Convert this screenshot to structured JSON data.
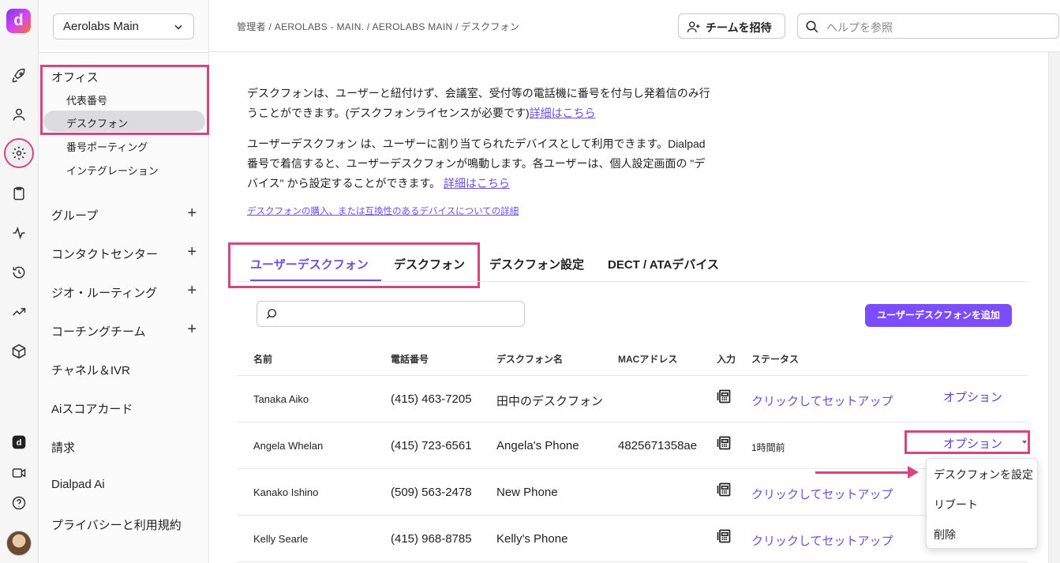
{
  "rail": {
    "logo": "d",
    "icons": [
      "rocket-icon",
      "person-icon",
      "gear-icon",
      "clipboard-icon",
      "activity-icon",
      "history-icon",
      "trending-icon",
      "cube-icon",
      "dialpad-icon",
      "video-icon",
      "help-icon",
      "avatar"
    ]
  },
  "nav": {
    "org": "Aerolabs Main",
    "office": "オフィス",
    "sub_items": [
      "代表番号",
      "デスクフォン",
      "番号ポーティング",
      "インテグレーション"
    ],
    "groups": [
      {
        "label": "グループ",
        "plus": "+"
      },
      {
        "label": "コンタクトセンター",
        "plus": "+"
      },
      {
        "label": "ジオ・ルーティング",
        "plus": "+"
      },
      {
        "label": "コーチングチーム",
        "plus": "+"
      },
      {
        "label": "チャネル＆IVR",
        "plus": ""
      },
      {
        "label": "Aiスコアカード",
        "plus": ""
      },
      {
        "label": "請求",
        "plus": ""
      },
      {
        "label": "Dialpad Ai",
        "plus": ""
      },
      {
        "label": "プライバシーと利用規約",
        "plus": ""
      }
    ]
  },
  "header": {
    "breadcrumb": "管理者 / AEROLABS - MAIN. / AEROLABS MAIN / デスクフォン",
    "invite_label": "チームを招待",
    "search_placeholder": "ヘルプを参照"
  },
  "intro": {
    "p1_line1": "デスクフォンは、ユーザーと紐付けず、会議室、受付等の電話機に番号を付与し発着信のみ行",
    "p1_line2": "うことができます。(デスクフォンライセンスが必要です)",
    "p1_link": "詳細はこちら",
    "p2_line1": "ユーザーデスクフォン は、ユーザーに割り当てられたデバイスとして利用できます。Dialpad",
    "p2_line2": "番号で着信すると、ユーザーデスクフォンが鳴動します。各ユーザーは、個人設定画面の \"デ",
    "p2_line3": "バイス\" から設定することができます。",
    "p2_link": "詳細はこちら",
    "purchase_link": "デスクフォンの購入、または互換性のあるデバイスについての詳細"
  },
  "tabs": [
    "ユーザーデスクフォン",
    "デスクフォン",
    "デスクフォン設定",
    "DECT / ATAデバイス"
  ],
  "add_button": "ユーザーデスクフォンを追加",
  "table": {
    "headers": [
      "名前",
      "電話番号",
      "デスクフォン名",
      "MACアドレス",
      "入力",
      "ステータス"
    ],
    "rows": [
      {
        "name": "Tanaka Aiko",
        "phone": "(415) 463-7205",
        "device": "田中のデスクフォン",
        "mac": "",
        "status": "クリックしてセットアップ",
        "option": "オプション"
      },
      {
        "name": "Angela Whelan",
        "phone": "(415) 723-6561",
        "device": "Angela's Phone",
        "mac": "4825671358ae",
        "status": "1時間前",
        "option": "オプション"
      },
      {
        "name": "Kanako Ishino",
        "phone": "(509) 563-2478",
        "device": "New Phone",
        "mac": "",
        "status": "クリックしてセットアップ",
        "option": ""
      },
      {
        "name": "Kelly Searle",
        "phone": "(415) 968-8785",
        "device": "Kelly's Phone",
        "mac": "",
        "status": "クリックしてセットアップ",
        "option": ""
      }
    ]
  },
  "menu": [
    "デスクフォンを設定",
    "リブート",
    "削除"
  ],
  "colors": {
    "accent": "#6b4ee6",
    "highlight": "#d6457f",
    "button": "#7c4dff"
  }
}
